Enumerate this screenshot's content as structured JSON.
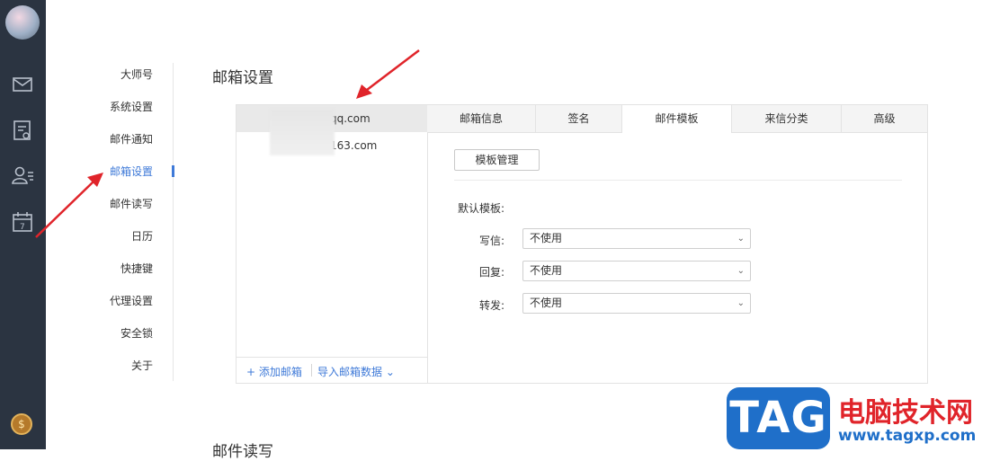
{
  "sidebar": {
    "icons": [
      "mail-icon",
      "notes-icon",
      "contacts-icon",
      "calendar-icon",
      "coin-icon"
    ],
    "calendar_day": "7",
    "coin_symbol": "$"
  },
  "settings_nav": {
    "items": [
      "大师号",
      "系统设置",
      "邮件通知",
      "邮箱设置",
      "邮件读写",
      "日历",
      "快捷键",
      "代理设置",
      "安全锁",
      "关于"
    ],
    "active_index": 3
  },
  "page": {
    "title": "邮箱设置",
    "next_section_title": "邮件读写"
  },
  "accounts": {
    "items": [
      "@qq.com",
      "@163.com"
    ],
    "selected_index": 0,
    "add_label": "+ 添加邮箱",
    "import_label": "导入邮箱数据 ⌄"
  },
  "tabs": {
    "items": [
      "邮箱信息",
      "签名",
      "邮件模板",
      "来信分类",
      "高级"
    ],
    "active_index": 2
  },
  "template_panel": {
    "manage_button": "模板管理",
    "default_label": "默认模板:",
    "rows": [
      {
        "label": "写信:",
        "value": "不使用"
      },
      {
        "label": "回复:",
        "value": "不使用"
      },
      {
        "label": "转发:",
        "value": "不使用"
      }
    ]
  },
  "watermark": {
    "logo_text": "TAG",
    "site_name": "电脑技术网",
    "url": "www.tagxp.com"
  },
  "colors": {
    "accent": "#3f7ad8",
    "rail": "#2b3441",
    "annotation_arrow": "#e0242a"
  }
}
